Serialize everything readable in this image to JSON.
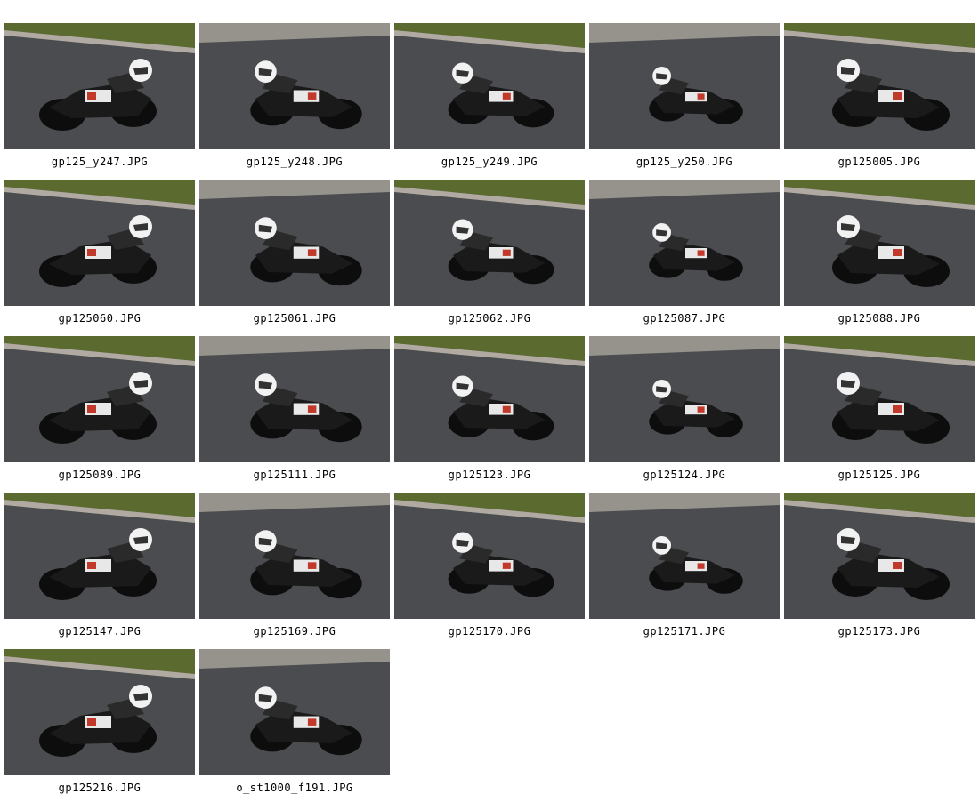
{
  "gallery": {
    "items": [
      {
        "filename": "gp125_y247.JPG",
        "thumb": "bike-photo-thumbnail"
      },
      {
        "filename": "gp125_y248.JPG",
        "thumb": "bike-photo-thumbnail"
      },
      {
        "filename": "gp125_y249.JPG",
        "thumb": "bike-photo-thumbnail"
      },
      {
        "filename": "gp125_y250.JPG",
        "thumb": "bike-photo-thumbnail"
      },
      {
        "filename": "gp125005.JPG",
        "thumb": "bike-photo-thumbnail"
      },
      {
        "filename": "gp125060.JPG",
        "thumb": "bike-photo-thumbnail"
      },
      {
        "filename": "gp125061.JPG",
        "thumb": "bike-photo-thumbnail"
      },
      {
        "filename": "gp125062.JPG",
        "thumb": "bike-photo-thumbnail"
      },
      {
        "filename": "gp125087.JPG",
        "thumb": "bike-photo-thumbnail"
      },
      {
        "filename": "gp125088.JPG",
        "thumb": "bike-photo-thumbnail"
      },
      {
        "filename": "gp125089.JPG",
        "thumb": "bike-photo-thumbnail"
      },
      {
        "filename": "gp125111.JPG",
        "thumb": "bike-photo-thumbnail"
      },
      {
        "filename": "gp125123.JPG",
        "thumb": "bike-photo-thumbnail"
      },
      {
        "filename": "gp125124.JPG",
        "thumb": "bike-photo-thumbnail"
      },
      {
        "filename": "gp125125.JPG",
        "thumb": "bike-photo-thumbnail"
      },
      {
        "filename": "gp125147.JPG",
        "thumb": "bike-photo-thumbnail"
      },
      {
        "filename": "gp125169.JPG",
        "thumb": "bike-photo-thumbnail"
      },
      {
        "filename": "gp125170.JPG",
        "thumb": "bike-photo-thumbnail"
      },
      {
        "filename": "gp125171.JPG",
        "thumb": "bike-photo-thumbnail"
      },
      {
        "filename": "gp125173.JPG",
        "thumb": "bike-photo-thumbnail"
      },
      {
        "filename": "gp125216.JPG",
        "thumb": "bike-photo-thumbnail"
      },
      {
        "filename": "o_st1000_f191.JPG",
        "thumb": "bike-photo-thumbnail"
      }
    ]
  },
  "colors": {
    "track": "#4a4c4f",
    "grass": "#5b6a2e",
    "curb": "#c9c2b6",
    "bike_body": "#1a1a1a",
    "helmet": "#f2f2f2",
    "accent": "#c0392b"
  }
}
